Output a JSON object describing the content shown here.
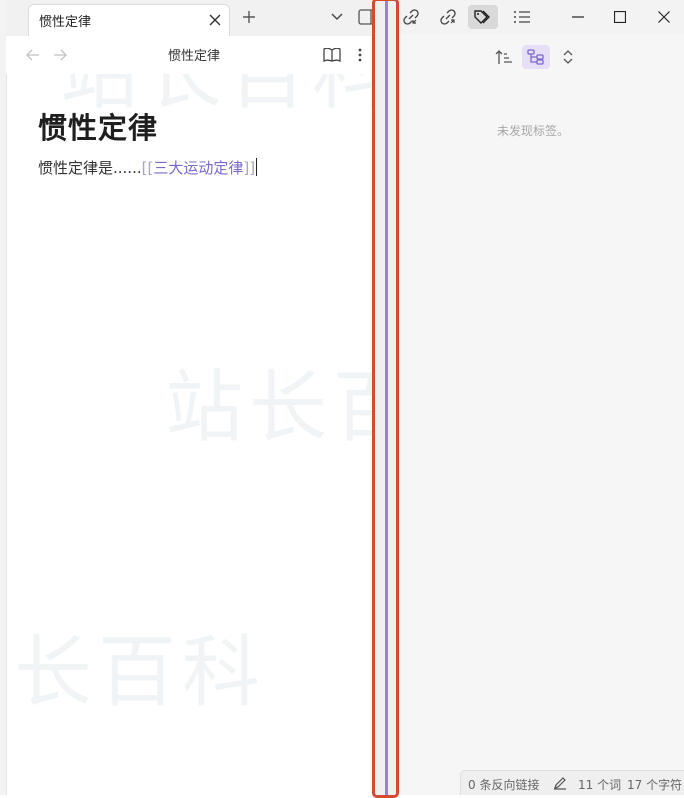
{
  "tab": {
    "title": "惯性定律"
  },
  "view_header": {
    "title": "惯性定律"
  },
  "note": {
    "heading": "惯性定律",
    "body_text": "惯性定律是......",
    "link_open": "[[",
    "link_text": "三大运动定律",
    "link_close": "]]"
  },
  "tags_panel": {
    "empty_message": "未发现标签。"
  },
  "status_bar": {
    "backlinks": "0 条反向链接",
    "words": "11 个词",
    "characters": "17 个字符"
  },
  "watermark": {
    "text": "站长百科"
  },
  "colors": {
    "accent": "#7b68c9",
    "divider_line": "#9b7fd6",
    "highlight_border": "#d44a33"
  },
  "icons": {
    "tab_close": "close-icon",
    "new_tab": "plus-icon",
    "tab_list": "chevron-down-icon",
    "sidebar_toggle": "sidebar-toggle-icon",
    "back": "arrow-left-icon",
    "forward": "arrow-right-icon",
    "reading_mode": "book-open-icon",
    "more": "more-vertical-icon",
    "backlinks": "link-in-icon",
    "outgoing_links": "link-out-icon",
    "tags": "tags-icon",
    "outline": "list-icon",
    "sort": "sort-icon",
    "tree": "tree-icon",
    "collapse": "expand-collapse-icon",
    "edit": "pencil-icon"
  }
}
